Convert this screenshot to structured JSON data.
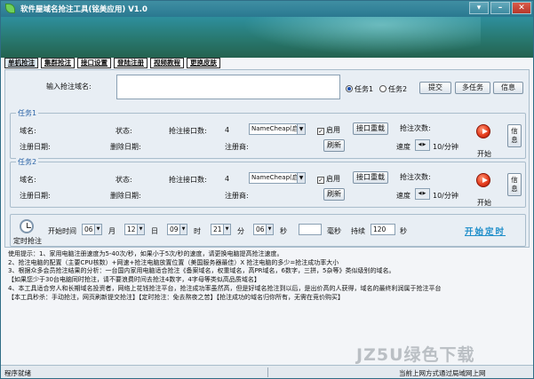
{
  "window": {
    "title": "软件屋域名抢注工具(铭美应用)  V1.0"
  },
  "tabs": [
    "单机抢注",
    "集群抢注",
    "接口设置",
    "登陆注册",
    "视频教程",
    "更换皮肤"
  ],
  "top": {
    "domain_label": "输入抢注域名:",
    "task1_radio": "任务1",
    "task2_radio": "任务2",
    "submit": "提交",
    "multitask": "多任务",
    "info": "信息"
  },
  "task1": {
    "title": "任务1",
    "domain_label": "域名:",
    "status_label": "状态:",
    "iface_count_label": "抢注接口数:",
    "iface_count": "4",
    "provider": "NameCheap(启用",
    "enable": "启用",
    "reload": "接口重载",
    "attempts_label": "抢注次数:",
    "reg_date_label": "注册日期:",
    "del_date_label": "删除日期:",
    "registrar_label": "注册商:",
    "refresh": "刷新",
    "speed_label": "速度",
    "speed_value": "10/分钟",
    "start": "开始",
    "info": "信息"
  },
  "task2": {
    "title": "任务2",
    "domain_label": "域名:",
    "status_label": "状态:",
    "iface_count_label": "抢注接口数:",
    "iface_count": "4",
    "provider": "NameCheap(启用",
    "enable": "启用",
    "reload": "接口重载",
    "attempts_label": "抢注次数:",
    "reg_date_label": "注册日期:",
    "del_date_label": "删除日期:",
    "registrar_label": "注册商:",
    "refresh": "刷新",
    "speed_label": "速度",
    "speed_value": "10/分钟",
    "start": "开始",
    "info": "信息"
  },
  "timer": {
    "label": "定时抢注",
    "start_time_label": "开始时间",
    "month_val": "06",
    "month_label": "月",
    "day_val": "12",
    "day_label": "日",
    "hour_val": "09",
    "hour_label": "时",
    "min_val": "21",
    "min_label": "分",
    "sec_val": "06",
    "sec_label": "秒",
    "ms_label": "毫秒",
    "duration_label": "持续",
    "duration_val": "120",
    "duration_unit": "秒",
    "start_button": "开始定时"
  },
  "tips": [
    "使用提示：1、家用电脑注册速度为5-40次/秒，如果小于5次/秒的速度，请更换电脑提高抢注速度。",
    "2、抢注电脑的配置（主要CPU核数）+网速+抢注电脑放置位置（美国服务器最佳）X 抢注电脑的多少=抢注成功率大小",
    "3、根据众多会员抢注结果的分析：一台国内家用电脑适合抢注《备案域名，权重域名，高PR域名，6数字，三拼，5杂等》类似级别的域名。",
    "【如果您少于30台电脑同时抢注，请不要浪费时间去抢注4数字，4字母等类似高品质域名】",
    "4、本工具适合穷人和长期域名投资者，网络上花钱抢注平台，抢注成功率虽然高，但是好域名抢注到以后，是出价高的人获得，域名的最终利润属于抢注平台",
    "【本工具秒杀：手动抢注，网页刷新提交抢注】【定时抢注：免去熬夜之苦】【抢注成功的域名归你所有，无需在竞价购买】"
  ],
  "status": {
    "left": "程序就绪",
    "right": "当前上网方式通过局域网上网"
  },
  "watermark": "JZ5U绿色下载"
}
